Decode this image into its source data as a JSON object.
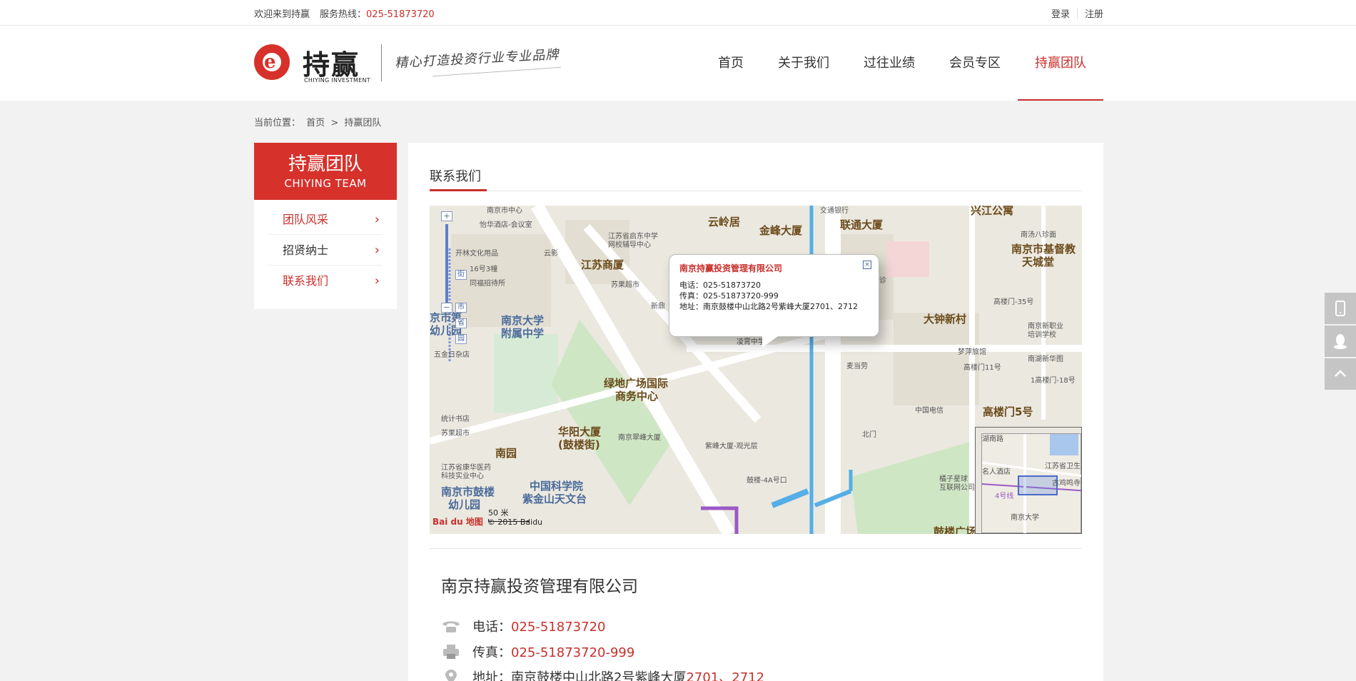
{
  "topbar": {
    "welcome": "欢迎来到持赢",
    "hotline_label": "服务热线：",
    "hotline": "025-51873720",
    "login": "登录",
    "register": "注册"
  },
  "header": {
    "logo_name": "持赢",
    "logo_sub": "CHIYING INVESTMENT",
    "slogan": "精心打造投资行业专业品牌",
    "nav": [
      {
        "label": "首页"
      },
      {
        "label": "关于我们"
      },
      {
        "label": "过往业绩"
      },
      {
        "label": "会员专区"
      },
      {
        "label": "持赢团队"
      }
    ]
  },
  "breadcrumb": {
    "label": "当前位置：",
    "home": "首页",
    "separator": ">",
    "current": "持赢团队"
  },
  "sidebar": {
    "title_cn": "持赢团队",
    "title_en": "CHIYING TEAM",
    "items": [
      {
        "label": "团队风采"
      },
      {
        "label": "招贤纳士"
      },
      {
        "label": "联系我们"
      }
    ],
    "chevron": "›"
  },
  "main": {
    "section_title": "联系我们"
  },
  "map": {
    "popup": {
      "title": "南京持赢投资管理有限公司",
      "phone": "电话：025-51873720",
      "fax": "传真：025-51873720-999",
      "address": "地址：南京鼓楼中山北路2号紫峰大厦2701、2712",
      "close": "×"
    },
    "labels": {
      "l1": "南京市中心",
      "l2": "怡华酒店-会议室",
      "l3": "江苏省启东中学",
      "l4": "网校辅导中心",
      "l5": "云岭居",
      "l6": "金峰大厦",
      "l7": "交通银行",
      "l8": "联通大厦",
      "l9": "兴江公寓",
      "l10": "南京市基督教",
      "l11": "天城堂",
      "l12": "开林文化用品",
      "l13": "16号3幢",
      "l14": "同福招待所",
      "l15": "云影",
      "l16": "江苏商厦",
      "l17": "苏果超市",
      "l18": "南京大学",
      "l19": "附属中学",
      "l20": "京市第",
      "l21": "幼儿园",
      "l22": "五金日杂店",
      "l23": "绿地广场国际",
      "l24": "商务中心",
      "l25": "大钟新村",
      "l26": "梦萍旅馆",
      "l27": "高楼门11号",
      "l28": "南京新职业",
      "l29": "培训学校",
      "l30": "南湖新华图",
      "l31": "高楼门5号",
      "l32": "中国电信",
      "l33": "统计书店",
      "l34": "苏果超市",
      "l35": "华阳大厦",
      "l36": "(鼓楼街)",
      "l37": "南京翠峰大厦",
      "l38": "紫峰大厦-观光层",
      "l39": "南园",
      "l40": "江苏省康华医药",
      "l41": "科技实业中心",
      "l42": "南京市鼓楼",
      "l43": "幼儿园",
      "l44": "中国科学院",
      "l45": "紫金山天文台",
      "l46": "鼓楼-4A号口",
      "l47": "北门",
      "l48": "橘子星球",
      "l49": "互联网公司",
      "l50": "鼓楼广场",
      "l51": "麦当劳",
      "l52": "凌霄中学",
      "l53": "高楼门-35号",
      "l54": "南汤八珍面",
      "l55": "新鼎",
      "l56": "诊",
      "l57": "1高楼门-18号",
      "l58": "街",
      "l59": "市",
      "l60": "省",
      "l61": "园"
    },
    "minimap_labels": {
      "m1": "湖南路",
      "m2": "名人酒店",
      "m3": "江苏省卫生",
      "m4": "古鸡鸣寺",
      "m5": "4号线",
      "m6": "南京大学"
    },
    "scale": "50 米",
    "brand": "Bai du 地图",
    "copyright": "© 2015 Baidu",
    "zoom_in": "+",
    "zoom_out": "−"
  },
  "contact": {
    "company": "南京持赢投资管理有限公司",
    "phone_label": "电话：",
    "phone": "025-51873720",
    "fax_label": "传真：",
    "fax": "025-51873720-999",
    "address_label": "地址：南京鼓楼中山北路2号紫峰大厦",
    "address_rooms": "2701、2712"
  },
  "float_buttons": {
    "icons": [
      "mobile-icon",
      "qq-icon",
      "back-to-top-icon"
    ]
  }
}
